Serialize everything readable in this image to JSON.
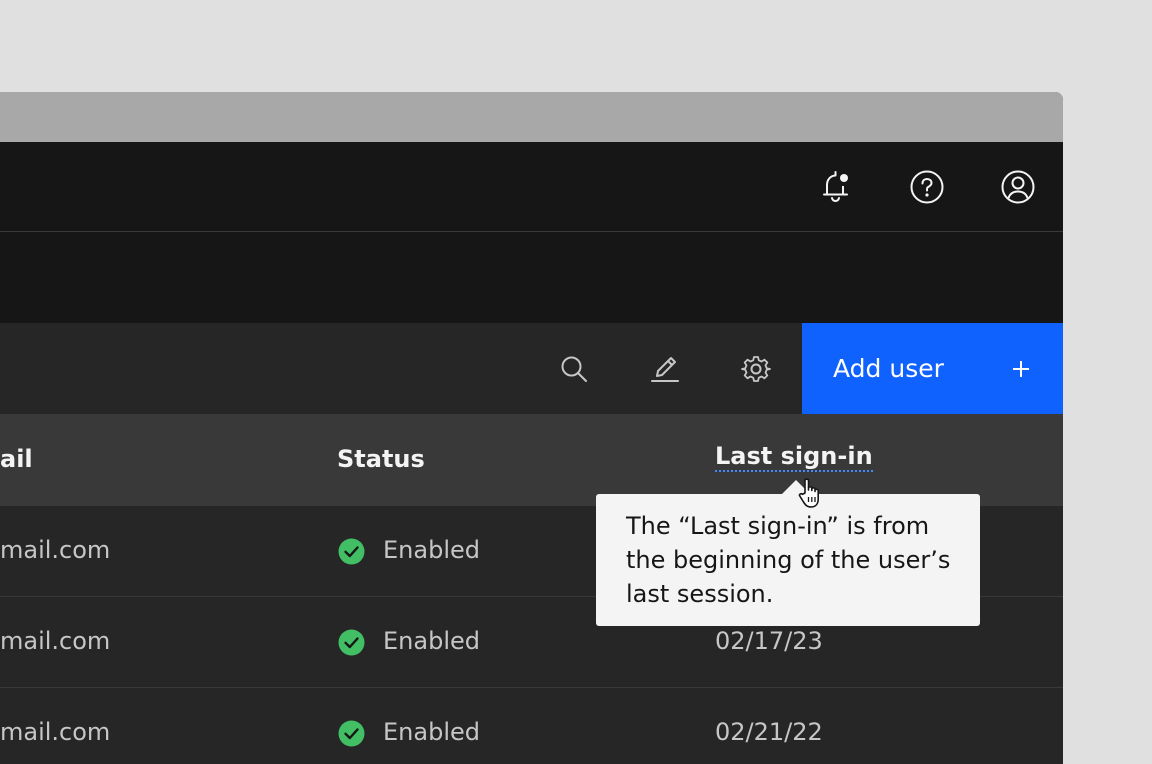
{
  "header": {
    "icons": [
      "notification-new-icon",
      "help-icon",
      "user-avatar-icon"
    ]
  },
  "toolbar": {
    "icons": [
      "search-icon",
      "edit-icon",
      "settings-icon"
    ],
    "add_button_label": "Add user",
    "add_button_icon": "plus-icon"
  },
  "table": {
    "headers": {
      "email": "ail",
      "status": "Status",
      "last_signin": "Last sign-in"
    },
    "rows": [
      {
        "email": "mail.com",
        "status": "Enabled",
        "last_signin": ""
      },
      {
        "email": "mail.com",
        "status": "Enabled",
        "last_signin": "02/17/23"
      },
      {
        "email": "mail.com",
        "status": "Enabled",
        "last_signin": "02/21/22"
      }
    ]
  },
  "tooltip": {
    "lines": [
      "The “Last sign-in” is from",
      "the beginning of the user’s",
      "last session."
    ]
  },
  "colors": {
    "primary_button": "#0f62fe",
    "status_enabled": "#42be65",
    "tooltip_bg": "#f4f4f4",
    "header_bg": "#161616",
    "toolbar_bg": "#262626",
    "table_header_bg": "#393939"
  }
}
